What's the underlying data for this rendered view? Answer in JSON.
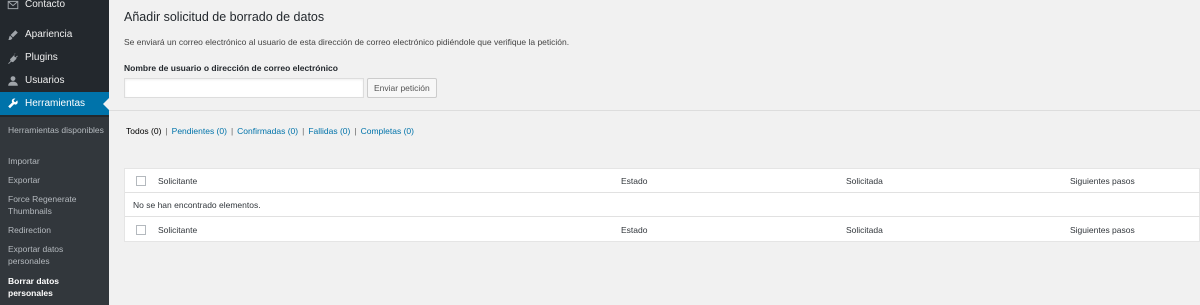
{
  "sidebar": {
    "items": [
      {
        "label": "Contacto",
        "icon": "mail-icon"
      },
      {
        "label": "Apariencia",
        "icon": "brush-icon"
      },
      {
        "label": "Plugins",
        "icon": "plugin-icon"
      },
      {
        "label": "Usuarios",
        "icon": "users-icon"
      },
      {
        "label": "Herramientas",
        "icon": "wrench-icon",
        "current": true
      }
    ],
    "submenu": [
      "Herramientas disponibles",
      "Importar",
      "Exportar",
      "Force Regenerate Thumbnails",
      "Redirection",
      "Exportar datos personales",
      "Borrar datos personales"
    ]
  },
  "main": {
    "title": "Añadir solicitud de borrado de datos",
    "description": "Se enviará un correo electrónico al usuario de esta dirección de correo electrónico pidiéndole que verifique la petición.",
    "field_label": "Nombre de usuario o dirección de correo electrónico",
    "input_value": "",
    "button_label": "Enviar petición",
    "filters": {
      "all": "Todos (0)",
      "pending": "Pendientes (0)",
      "confirmed": "Confirmadas (0)",
      "failed": "Fallidas (0)",
      "completed": "Completas (0)",
      "separator": "|"
    },
    "table": {
      "columns": [
        "Solicitante",
        "Estado",
        "Solicitada",
        "Siguientes pasos"
      ],
      "empty_message": "No se han encontrado elementos."
    }
  },
  "colors": {
    "sidebar_bg": "#23282d",
    "submenu_bg": "#32373c",
    "accent": "#0073aa",
    "page_bg": "#f1f1f1"
  }
}
